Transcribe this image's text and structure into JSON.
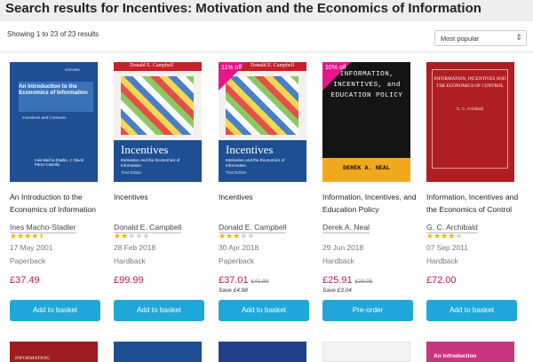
{
  "page": {
    "title": "Search results for Incentives: Motivation and the Economics of Information",
    "showing": "Showing 1 to 23 of 23 results",
    "sort": {
      "selected": "Most popular",
      "icon": "chevron-updown-icon"
    }
  },
  "colors": {
    "accent_button": "#1ea7d8",
    "price": "#c2185b",
    "star": "#f5b400",
    "discount_tag": "#e6158a"
  },
  "books": [
    {
      "cover": {
        "title": "An Introduction to the Economics of Information",
        "subtitle": "Incentives and Contracts",
        "authors": "Inés Macho-Stadler, J. David Pérez-Castrillo",
        "publisher": "OXFORD"
      },
      "title": "An Introduction to the Economics of Information",
      "author": "Ines Macho-Stadler",
      "rating": 4.5,
      "date": "17 May 2001",
      "format": "Paperback",
      "price": "£37.49",
      "button": "Add to basket"
    },
    {
      "cover": {
        "author": "Donald E. Campbell",
        "title": "Incentives",
        "subtitle": "Motivation and the Economics of Information",
        "edition": "Third Edition"
      },
      "title": "Incentives",
      "author": "Donald E. Campbell",
      "rating": 2,
      "date": "28 Feb 2018",
      "format": "Hardback",
      "price": "£99.99",
      "button": "Add to basket"
    },
    {
      "cover": {
        "author": "Donald E. Campbell",
        "title": "Incentives",
        "subtitle": "Motivation and the Economics of Information",
        "edition": "Third Edition",
        "tag": "11% off"
      },
      "title": "Incentives",
      "author": "Donald E. Campbell",
      "rating": 3,
      "date": "30 Apr 2018",
      "format": "Paperback",
      "price": "£37.01",
      "old_price": "£41.99",
      "save": "Save £4.98",
      "button": "Add to basket"
    },
    {
      "cover": {
        "title": "INFORMATION, INCENTIVES, and EDUCATION POLICY",
        "author": "DEREK A. NEAL",
        "tag": "10% off"
      },
      "title": "Information, Incentives, and Education Policy",
      "author": "Derek A. Neal",
      "date": "29 Jun 2018",
      "format": "Hardback",
      "price": "£25.91",
      "old_price": "£28.95",
      "save": "Save £3.04",
      "button": "Pre-order"
    },
    {
      "cover": {
        "title": "INFORMATION, INCENTIVES AND THE ECONOMICS OF CONTROL",
        "author": "G. C. Archibald"
      },
      "title": "Information, Incentives and the Economics of Control",
      "author": "G. C. Archibald",
      "rating": 4,
      "date": "07 Sep 2011",
      "format": "Hardback",
      "price": "£72.00",
      "button": "Add to basket"
    }
  ],
  "bottom_row": [
    {
      "cover_text": "INFORMATION,"
    },
    {
      "cover_text": ""
    },
    {
      "cover_text": ""
    },
    {
      "cover_text": ""
    },
    {
      "cover_text": "An Introduction"
    }
  ]
}
